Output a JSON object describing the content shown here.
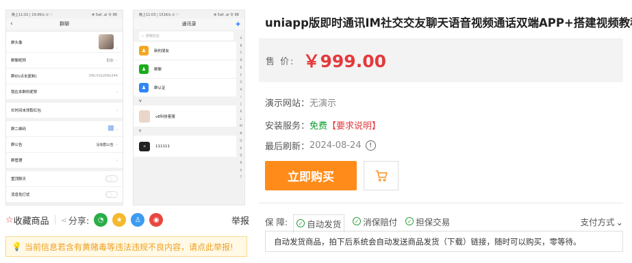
{
  "left": {
    "phone1": {
      "status_left": "晚上11:02 | 19.0K/s ⊙ ♡",
      "status_right": "✻ 5all .al 令 88",
      "nav_title": "群聊",
      "rows": [
        {
          "label": "群头像",
          "value": ""
        },
        {
          "label": "群聊昵称",
          "value": "群聊"
        },
        {
          "label": "群ID(点击复制)",
          "value": "3f6c41b266e344"
        },
        {
          "label": "我在本群的昵称",
          "value": ""
        },
        {
          "label": "长时间未领取红包",
          "value": ""
        },
        {
          "label": "群二维码",
          "value": ""
        },
        {
          "label": "群公告",
          "value": "没有群公告"
        },
        {
          "label": "群管理",
          "value": ""
        },
        {
          "label": "置顶聊天",
          "value": ""
        },
        {
          "label": "消息免打扰",
          "value": ""
        }
      ]
    },
    "phone2": {
      "status_left": "晚上11:03 | 151K/s ⊙ ♡",
      "status_right": "✻ 5all .al 令 88",
      "nav_title": "通讯录",
      "search_placeholder": "搜索好友",
      "items": [
        {
          "label": "新的朋友",
          "color": "#f5a623"
        },
        {
          "label": "群聊",
          "color": "#1aad19"
        },
        {
          "label": "群认证",
          "color": "#2f86f6"
        }
      ],
      "section_v": "V",
      "contact_v": "v8科技客服",
      "section_y": "Y",
      "contact_y": "111111",
      "alphabet": [
        "A",
        "B",
        "C",
        "D",
        "E",
        "F",
        "G",
        "H",
        "I",
        "J",
        "K",
        "L",
        "M",
        "N",
        "O",
        "P",
        "Q",
        "R",
        "S",
        "T"
      ]
    },
    "toolbar": {
      "fav_label": "收藏商品",
      "share_label": "分享:",
      "report_label": "举报"
    },
    "warning": "当前信息若含有黄赌毒等违法违规不良内容，请点此举报!"
  },
  "product": {
    "title": "uniapp版即时通讯IM社交交友聊天语音视频通话双端APP+搭建视频教程",
    "price_label": "售 价:",
    "price": "￥999.00",
    "demo_label": "演示网站：",
    "demo_value": "无演示",
    "install_label": "安装服务：",
    "install_value": "免费",
    "install_req": "【要求说明】",
    "refresh_label": "最后刷新：",
    "refresh_value": "2024-08-24",
    "buy_label": "立即购买",
    "guard_label": "保 障:",
    "guards": [
      "自动发货",
      "消保赔付",
      "担保交易"
    ],
    "pay_label": "支付方式",
    "desc": "自动发货商品，拍下后系统会自动发送商品发货（下载）链接，随时可以购买，零等待。"
  },
  "colors": {
    "accent": "#ff8c1a",
    "price": "#e4393c",
    "free": "#0a9b28"
  }
}
